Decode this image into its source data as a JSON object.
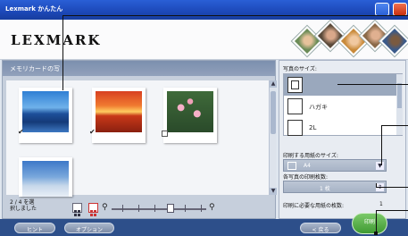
{
  "window": {
    "title": "Lexmark かんたん"
  },
  "header": {
    "logo": "LEXMARK"
  },
  "left_panel": {
    "title": "メモリカードの写",
    "photos": [
      {
        "name": "blue-mountains",
        "checked": true
      },
      {
        "name": "sunset",
        "checked": true
      },
      {
        "name": "water-lilies",
        "checked": false
      },
      {
        "name": "winter-landscape",
        "checked": false
      }
    ],
    "status_line1": "2 / 4 を選",
    "status_line2": "択しました"
  },
  "right_panel": {
    "photo_size_label": "写真のサイズ:",
    "sizes": [
      {
        "label": "",
        "selected": true
      },
      {
        "label": "ハガキ",
        "selected": false
      },
      {
        "label": "2L",
        "selected": false
      }
    ],
    "paper_size_label": "印刷する用紙のサイズ:",
    "paper_size_value": "A4",
    "copies_label": "各写真の印刷枚数:",
    "copies_value": "1 枚",
    "needed_label": "印刷に必要な用紙の枚数:",
    "needed_value": "1"
  },
  "bottom": {
    "hint": "ヒント",
    "options": "オプション",
    "back": "< 戻る",
    "print": "印刷"
  },
  "colors": {
    "titlebar": "#1c48b8",
    "bottombar": "#2d4f8a",
    "print_green": "#3f9a32"
  }
}
